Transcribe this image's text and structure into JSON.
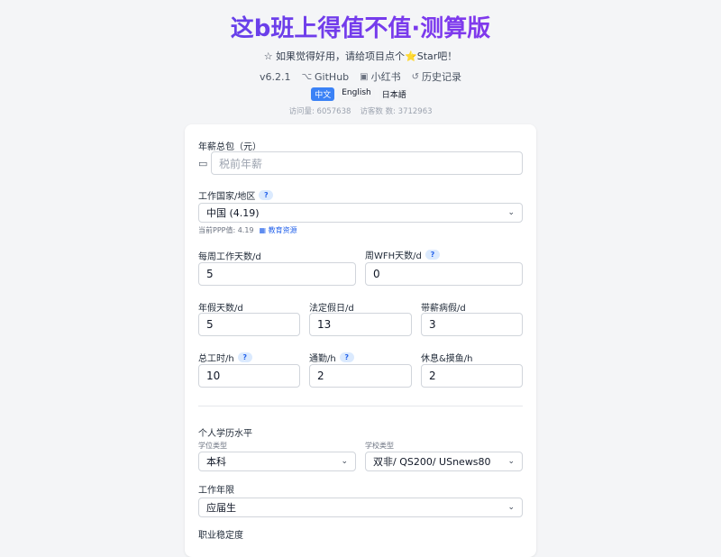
{
  "header": {
    "title": "这b班上得值不值·测算版",
    "tagline": "☆ 如果觉得好用，请给项目点个⭐Star吧！",
    "version": "v6.2.1",
    "github": "GitHub",
    "xiaohongshu": "小红书",
    "history": "历史记录",
    "languages": [
      "中文",
      "English",
      "日本語"
    ],
    "visits": "访问量: 6057638",
    "visitors": "访客数 数: 3712963"
  },
  "form": {
    "salary": {
      "label": "年薪总包（元）",
      "placeholder": "税前年薪",
      "value": ""
    },
    "country": {
      "label": "工作国家/地区",
      "help": "?",
      "value": "中国 (4.19)",
      "ppp": "当前PPP值: 4.19",
      "edu_link": "▦ 教育资源"
    },
    "workdays": {
      "label": "每周工作天数/d",
      "value": "5"
    },
    "wfh": {
      "label": "周WFH天数/d",
      "help": "?",
      "value": "0"
    },
    "annual_leave": {
      "label": "年假天数/d",
      "value": "5"
    },
    "holidays": {
      "label": "法定假日/d",
      "value": "13"
    },
    "sick_leave": {
      "label": "带薪病假/d",
      "value": "3"
    },
    "total_hours": {
      "label": "总工时/h",
      "help": "?",
      "value": "10"
    },
    "commute": {
      "label": "通勤/h",
      "help": "?",
      "value": "2"
    },
    "rest": {
      "label": "休息&摸鱼/h",
      "value": "2"
    },
    "education": {
      "section_label": "个人学历水平",
      "degree_label": "学位类型",
      "degree_value": "本科",
      "school_label": "学校类型",
      "school_value": "双非/ QS200/ USnews80"
    },
    "experience": {
      "label": "工作年限",
      "value": "应届生"
    },
    "stability": {
      "label": "职业稳定度"
    }
  },
  "colors": {
    "accent": "#3b82f6",
    "title_start": "#4f46e5",
    "title_end": "#9333ea"
  }
}
